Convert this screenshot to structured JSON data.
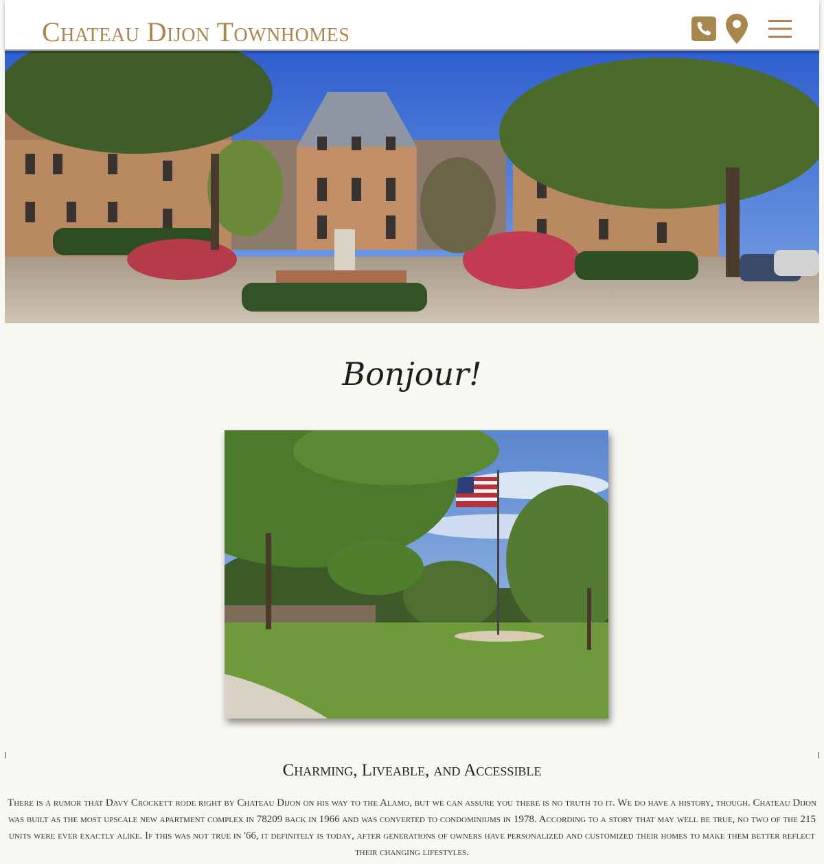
{
  "header": {
    "site_title": "Chateau Dijon Townhomes",
    "icons": [
      "phone-icon",
      "map-pin-icon",
      "hamburger-menu-icon"
    ]
  },
  "colors": {
    "accent_gold": "#a8874f",
    "background": "#f8f7f3",
    "header_bg": "#ffffff"
  },
  "main": {
    "greeting": "Bonjour!",
    "section_title": "Charming, Liveable, and Accessible",
    "intro_text": "There is a rumor that Davy Crockett rode right by Chateau Dijon on his way to the Alamo, but we can assure you there is no truth to it. We do have a history, though. Chateau Dijon was built as the most upscale new apartment complex in 78209 back in 1966 and was converted to condominiums in 1978. According to a story that may well be true, no two of the 215 units were ever exactly alike. If this was not true in '66, it definitely is today, after generations of owners have personalized and customized their homes to make them better reflect their changing lifestyles."
  }
}
